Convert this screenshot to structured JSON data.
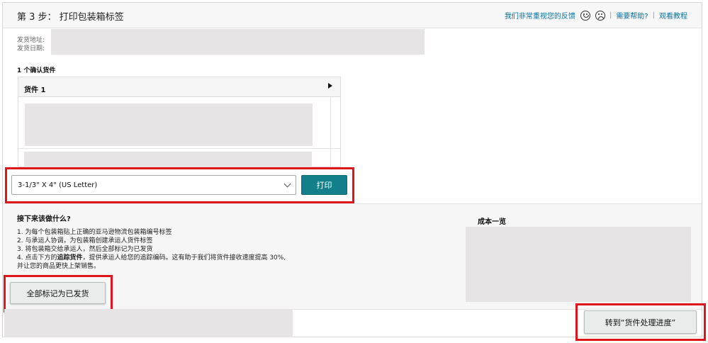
{
  "header": {
    "step_title": "第 3 步：  打印包装箱标签",
    "feedback_link": "我们非常重视您的反馈",
    "separator": "|",
    "help_link": "需要帮助?",
    "tutorial_link": "观看教程"
  },
  "meta": {
    "ship_from_label": "发货地址:",
    "ship_date_label": "发货日期:"
  },
  "shipments": {
    "confirm_title": "1 个确认货件",
    "card_title": "货件 1"
  },
  "print": {
    "label_size_selected": "3-1/3\" X 4\" (US Letter)",
    "print_button": "打印"
  },
  "next_steps": {
    "title": "接下来该做什么?",
    "items": [
      "1. 为每个包装箱贴上正确的亚马逊物流包装箱编号标签",
      "2. 与承运人协调，为包装箱创建承运人货件标签",
      "3. 将包装箱交给承运人，然后全部标记为已发货"
    ],
    "item4_prefix": "4. 点击下方的",
    "item4_bold": "追踪货件",
    "item4_suffix": "，提供承运人给您的追踪编码。这有助于我们将货件接收速度提高 30%,",
    "item4_line2": "并让您的商品更快上架销售。"
  },
  "cost": {
    "title": "成本一览"
  },
  "actions": {
    "mark_all_shipped": "全部标记为已发货",
    "go_to_progress": "转到“货件处理进度”"
  },
  "colors": {
    "accent": "#127f8a",
    "highlight": "#e0141c",
    "link": "#0b6f9e"
  }
}
